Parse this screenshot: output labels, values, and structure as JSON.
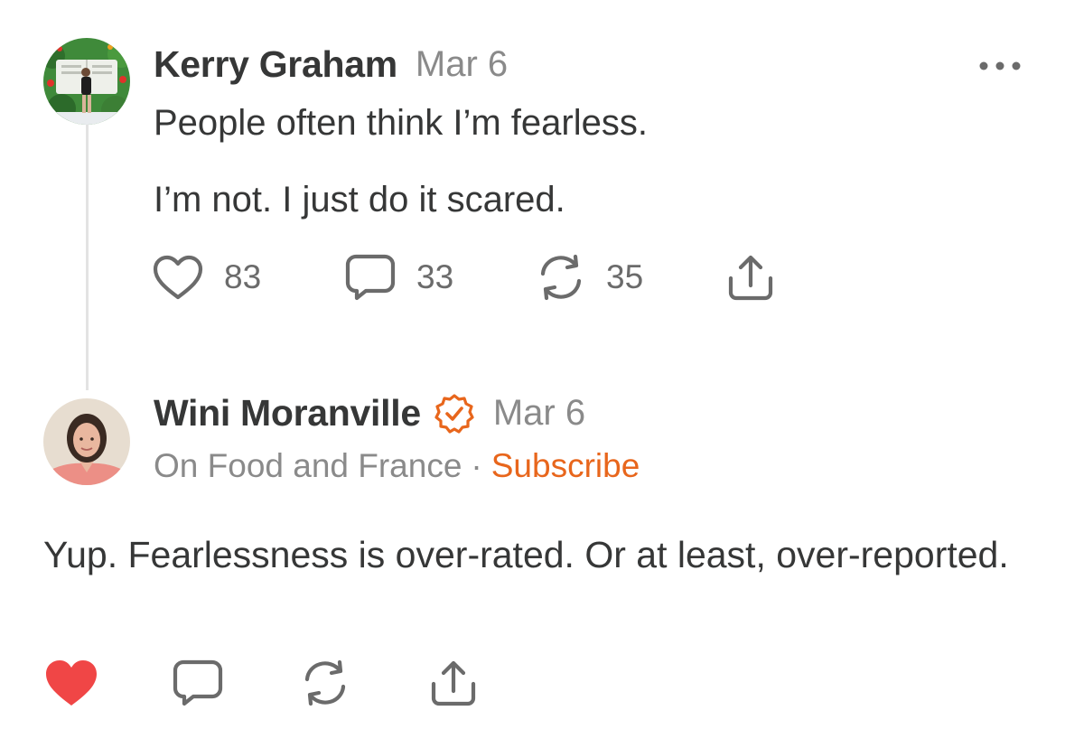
{
  "colors": {
    "text": "#363737",
    "muted": "#8a8a8a",
    "accent": "#e8661c",
    "liked": "#f04646",
    "thread_line": "#e3e3e3"
  },
  "post": {
    "author": "Kerry Graham",
    "date": "Mar 6",
    "avatar_icon": "avatar-photo-garden",
    "paragraphs": [
      "People often think I’m fearless.",
      "I’m not. I just do it scared."
    ],
    "actions": {
      "like_icon": "heart-outline-icon",
      "like_count": "83",
      "comment_icon": "speech-bubble-icon",
      "comment_count": "33",
      "restack_icon": "restack-icon",
      "restack_count": "35",
      "share_icon": "share-icon"
    },
    "menu_icon": "more-horizontal-icon"
  },
  "reply": {
    "author": "Wini Moranville",
    "verified_icon": "verified-badge-icon",
    "date": "Mar 6",
    "publication": "On Food and France",
    "separator": "·",
    "subscribe_label": "Subscribe",
    "avatar_icon": "avatar-photo-portrait",
    "text": "Yup. Fearlessness is over-rated. Or at least, over-reported.",
    "actions": {
      "like_icon": "heart-filled-icon",
      "liked": true,
      "comment_icon": "speech-bubble-icon",
      "restack_icon": "restack-icon",
      "share_icon": "share-icon"
    }
  }
}
